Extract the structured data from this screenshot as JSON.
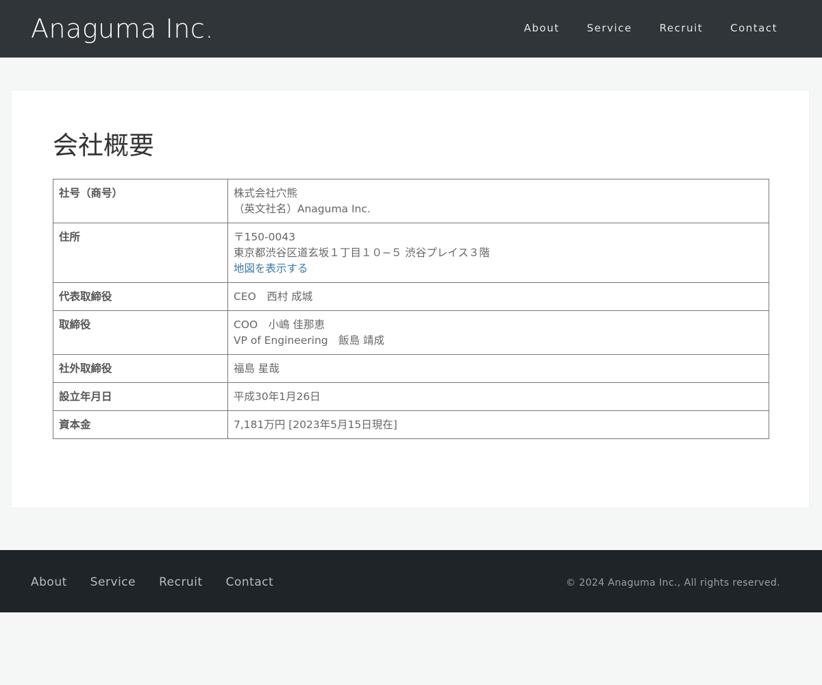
{
  "header": {
    "logo": "Anaguma Inc.",
    "nav": [
      "About",
      "Service",
      "Recruit",
      "Contact"
    ]
  },
  "main": {
    "title": "会社概要",
    "rows": [
      {
        "label": "社号（商号）",
        "lines": [
          "株式会社穴熊",
          "（英文社名）Anaguma Inc."
        ]
      },
      {
        "label": "住所",
        "lines": [
          "〒150-0043",
          "東京都渋谷区道玄坂１丁目１０−５ 渋谷プレイス３階"
        ],
        "link": "地図を表示する"
      },
      {
        "label": "代表取締役",
        "lines": [
          "CEO　西村 成城"
        ]
      },
      {
        "label": "取締役",
        "lines": [
          "COO　小嶋 佳那恵",
          "VP of Engineering　飯島 靖成"
        ]
      },
      {
        "label": "社外取締役",
        "lines": [
          "福島 星哉"
        ]
      },
      {
        "label": "設立年月日",
        "lines": [
          "平成30年1月26日"
        ]
      },
      {
        "label": "資本金",
        "lines": [
          "7,181万円 [2023年5月15日現在]"
        ]
      }
    ]
  },
  "footer": {
    "nav": [
      "About",
      "Service",
      "Recruit",
      "Contact"
    ],
    "copyright": "© 2024 Anaguma Inc., All rights reserved."
  },
  "colors": {
    "header_bg": "#2f3538",
    "footer_bg": "#1f2429",
    "page_bg": "#f4f7f6",
    "link": "#3a79a8"
  }
}
